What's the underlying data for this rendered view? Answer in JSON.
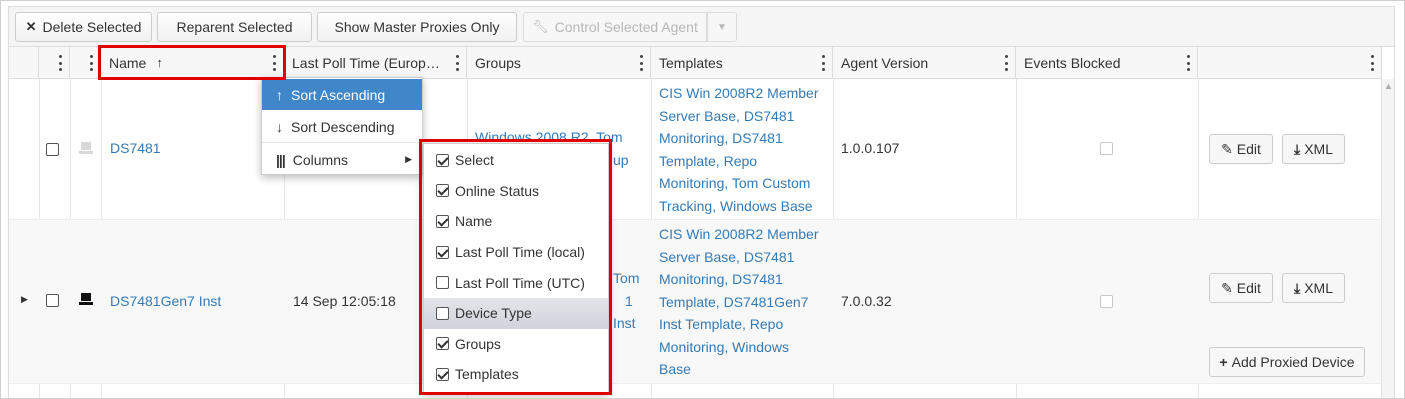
{
  "toolbar": {
    "delete_label": "Delete Selected",
    "reparent_label": "Reparent Selected",
    "master_label": "Show Master Proxies Only",
    "control_label": "Control Selected Agent"
  },
  "columns": {
    "name": "Name",
    "last_poll": "Last Poll Time (Europ…",
    "groups": "Groups",
    "templates": "Templates",
    "agent_version": "Agent Version",
    "events_blocked": "Events Blocked"
  },
  "rows": [
    {
      "name": "DS7481",
      "last_poll": "",
      "groups": "Windows 2008 R2, Tom",
      "groups_tail": "up",
      "templates": [
        "CIS Win 2008R2 Member",
        "Server Base, DS7481",
        "Monitoring, DS7481",
        "Template, Repo",
        "Monitoring, Tom Custom",
        "Tracking, Windows Base"
      ],
      "agent_version": "1.0.0.107",
      "edit_label": "Edit",
      "xml_label": "XML"
    },
    {
      "name": "DS7481Gen7 Inst",
      "last_poll": "14 Sep 12:05:18",
      "groups_frag": [
        "Tom",
        "1",
        "Inst"
      ],
      "templates": [
        "CIS Win 2008R2 Member",
        "Server Base, DS7481",
        "Monitoring, DS7481",
        "Template, DS7481Gen7",
        "Inst Template, Repo",
        "Monitoring, Windows",
        "Base"
      ],
      "agent_version": "7.0.0.32",
      "edit_label": "Edit",
      "xml_label": "XML",
      "add_proxied_label": "Add Proxied Device"
    }
  ],
  "sort_menu": {
    "items": [
      "Sort Ascending",
      "Sort Descending",
      "Columns"
    ]
  },
  "columns_menu": {
    "items": [
      {
        "label": "Select",
        "checked": true
      },
      {
        "label": "Online Status",
        "checked": true
      },
      {
        "label": "Name",
        "checked": true
      },
      {
        "label": "Last Poll Time (local)",
        "checked": true
      },
      {
        "label": "Last Poll Time (UTC)",
        "checked": false
      },
      {
        "label": "Device Type",
        "checked": false
      },
      {
        "label": "Groups",
        "checked": true
      },
      {
        "label": "Templates",
        "checked": true
      }
    ]
  },
  "colors": {
    "accent": "#3f87c9",
    "link": "#337ab7",
    "highlight": "#e00000"
  }
}
